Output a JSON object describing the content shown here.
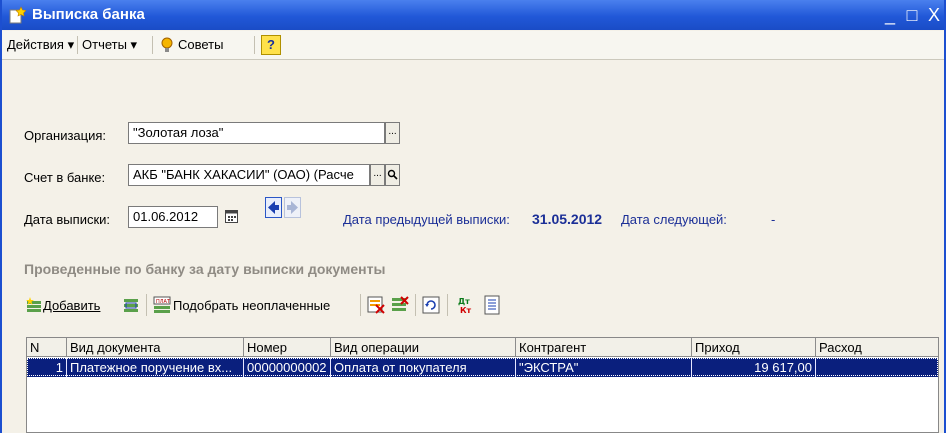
{
  "window": {
    "title": "Выписка банка",
    "controls": [
      "_",
      "□",
      "X"
    ]
  },
  "menu": {
    "actions": "Действия ▾",
    "reports": "Отчеты ▾",
    "tips": "Советы",
    "help": "?"
  },
  "form": {
    "organization_label": "Организация:",
    "organization_value": "\"Золотая лоза\"",
    "bank_account_label": "Счет в банке:",
    "bank_account_value": "АКБ \"БАНК ХАКАСИИ\" (ОАО) (Расче",
    "statement_date_label": "Дата выписки:",
    "statement_date_value": "01.06.2012",
    "prev_label": "Дата предыдущей выписки:",
    "prev_value": "31.05.2012",
    "next_label": "Дата следующей:",
    "next_value": "-"
  },
  "section_title": "Проведенные по банку за дату выписки документы",
  "toolbar": {
    "add": "Добавить",
    "pick_unpaid": "Подобрать неоплаченные"
  },
  "table": {
    "columns": [
      "N",
      "Вид документа",
      "Номер",
      "Вид операции",
      "Контрагент",
      "Приход",
      "Расход"
    ],
    "rows": [
      {
        "n": "1",
        "doc_type": "Платежное поручение вх...",
        "number": "00000000002",
        "operation": "Оплата от покупателя",
        "counterparty": "\"ЭКСТРА\"",
        "income": "19 617,00",
        "expense": ""
      }
    ]
  },
  "colors": {
    "title_bar": "#2158d8",
    "selected_row": "#0a1f7d",
    "label_blue": "#1b2f97",
    "background": "#f4f1e8"
  },
  "icons": [
    "document-star-icon",
    "lightbulb-icon",
    "help-icon",
    "calendar-icon",
    "arrow-left-icon",
    "arrow-right-icon",
    "add-icon",
    "edit-icon",
    "pick-icon",
    "delete-icon",
    "uncheck-icon",
    "refresh-icon",
    "debit-credit-icon",
    "report-icon"
  ]
}
